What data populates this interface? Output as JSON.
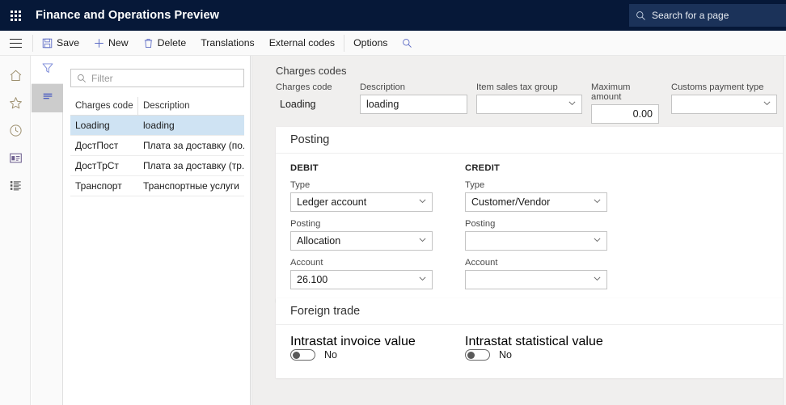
{
  "topbar": {
    "waffle_icon": "app-launcher-icon",
    "title": "Finance and Operations Preview",
    "search": {
      "icon": "search-icon",
      "placeholder": "Search for a page"
    }
  },
  "toolbar": {
    "menu_icon": "hamburger-menu-icon",
    "buttons": [
      {
        "label": "Save",
        "icon": "save-floppy-icon"
      },
      {
        "label": "New",
        "icon": "plus-icon"
      },
      {
        "label": "Delete",
        "icon": "trash-icon"
      },
      {
        "label": "Translations",
        "icon": ""
      },
      {
        "label": "External codes",
        "icon": ""
      },
      {
        "label": "Options",
        "icon": ""
      }
    ],
    "search_icon": "search-icon"
  },
  "rail": {
    "items": [
      {
        "name": "home",
        "icon": "home-icon"
      },
      {
        "name": "favorites",
        "icon": "star-icon"
      },
      {
        "name": "recent",
        "icon": "clock-icon"
      },
      {
        "name": "workspaces",
        "icon": "workspace-icon"
      },
      {
        "name": "modules",
        "icon": "list-modules-icon"
      }
    ]
  },
  "tabstrip": {
    "items": [
      {
        "name": "filter",
        "icon": "funnel-icon",
        "selected": false
      },
      {
        "name": "list",
        "icon": "lines-icon",
        "selected": true
      }
    ]
  },
  "gridpanel": {
    "filter": {
      "icon": "search-icon",
      "placeholder": "Filter",
      "value": ""
    },
    "columns": [
      "Charges code",
      "Description"
    ],
    "rows": [
      {
        "code": "Loading",
        "description": "loading",
        "selected": true
      },
      {
        "code": "ДостПост",
        "description": "Плата за доставку (по...",
        "selected": false
      },
      {
        "code": "ДостТрСт",
        "description": "Плата за доставку (тр...",
        "selected": false
      },
      {
        "code": "Транспорт",
        "description": "Транспортные услуги",
        "selected": false
      }
    ]
  },
  "main": {
    "page_title": "Charges codes",
    "header_fields": {
      "charges_code": {
        "label": "Charges code",
        "value": "Loading"
      },
      "description": {
        "label": "Description",
        "value": "loading"
      },
      "item_sales_tax_group": {
        "label": "Item sales tax group",
        "value": ""
      },
      "maximum_amount": {
        "label": "Maximum amount",
        "value": "0.00"
      },
      "customs_payment_type": {
        "label": "Customs payment type",
        "value": ""
      }
    },
    "posting": {
      "title": "Posting",
      "debit": {
        "title": "DEBIT",
        "type": {
          "label": "Type",
          "value": "Ledger account"
        },
        "posting": {
          "label": "Posting",
          "value": "Allocation"
        },
        "account": {
          "label": "Account",
          "value": "26.100"
        }
      },
      "credit": {
        "title": "CREDIT",
        "type": {
          "label": "Type",
          "value": "Customer/Vendor"
        },
        "posting": {
          "label": "Posting",
          "value": ""
        },
        "account": {
          "label": "Account",
          "value": ""
        }
      }
    },
    "foreign_trade": {
      "title": "Foreign trade",
      "intrastat_invoice_value": {
        "label": "Intrastat invoice value",
        "value": "No",
        "on": false
      },
      "intrastat_statistical_value": {
        "label": "Intrastat statistical value",
        "value": "No",
        "on": false
      }
    }
  },
  "colors": {
    "nav_bg": "#061838",
    "accent": "#5b6ac4",
    "selected_row": "#cfe3f3",
    "main_bg": "#f0efee"
  }
}
